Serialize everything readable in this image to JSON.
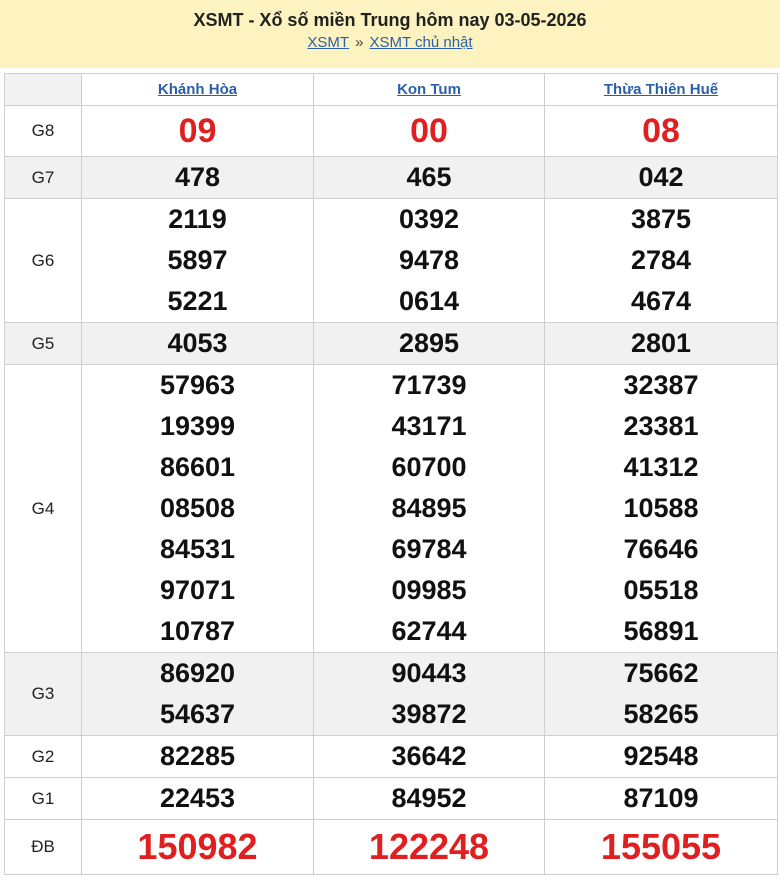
{
  "header": {
    "title": "XSMT - Xổ số miền Trung hôm nay 03-05-2026",
    "crumb_1": "XSMT",
    "crumb_sep": "»",
    "crumb_2": "XSMT chủ nhật"
  },
  "provinces": [
    "Khánh Hòa",
    "Kon Tum",
    "Thừa Thiên Huế"
  ],
  "prizes": [
    {
      "label": "G8",
      "shaded": false,
      "style": "g8",
      "results": [
        [
          "09"
        ],
        [
          "00"
        ],
        [
          "08"
        ]
      ]
    },
    {
      "label": "G7",
      "shaded": true,
      "style": "",
      "results": [
        [
          "478"
        ],
        [
          "465"
        ],
        [
          "042"
        ]
      ]
    },
    {
      "label": "G6",
      "shaded": false,
      "style": "",
      "results": [
        [
          "2119",
          "5897",
          "5221"
        ],
        [
          "0392",
          "9478",
          "0614"
        ],
        [
          "3875",
          "2784",
          "4674"
        ]
      ]
    },
    {
      "label": "G5",
      "shaded": true,
      "style": "",
      "results": [
        [
          "4053"
        ],
        [
          "2895"
        ],
        [
          "2801"
        ]
      ]
    },
    {
      "label": "G4",
      "shaded": false,
      "style": "",
      "results": [
        [
          "57963",
          "19399",
          "86601",
          "08508",
          "84531",
          "97071",
          "10787"
        ],
        [
          "71739",
          "43171",
          "60700",
          "84895",
          "69784",
          "09985",
          "62744"
        ],
        [
          "32387",
          "23381",
          "41312",
          "10588",
          "76646",
          "05518",
          "56891"
        ]
      ]
    },
    {
      "label": "G3",
      "shaded": true,
      "style": "",
      "results": [
        [
          "86920",
          "54637"
        ],
        [
          "90443",
          "39872"
        ],
        [
          "75662",
          "58265"
        ]
      ]
    },
    {
      "label": "G2",
      "shaded": false,
      "style": "",
      "results": [
        [
          "82285"
        ],
        [
          "36642"
        ],
        [
          "92548"
        ]
      ]
    },
    {
      "label": "G1",
      "shaded": false,
      "style": "",
      "results": [
        [
          "22453"
        ],
        [
          "84952"
        ],
        [
          "87109"
        ]
      ]
    },
    {
      "label": "ĐB",
      "shaded": false,
      "style": "big",
      "results": [
        [
          "150982"
        ],
        [
          "122248"
        ],
        [
          "155055"
        ]
      ]
    }
  ],
  "colors": {
    "header_bg": "#fcf3c0",
    "link": "#2b5fa8",
    "highlight": "#e02020",
    "shade": "#f1f1f1"
  }
}
